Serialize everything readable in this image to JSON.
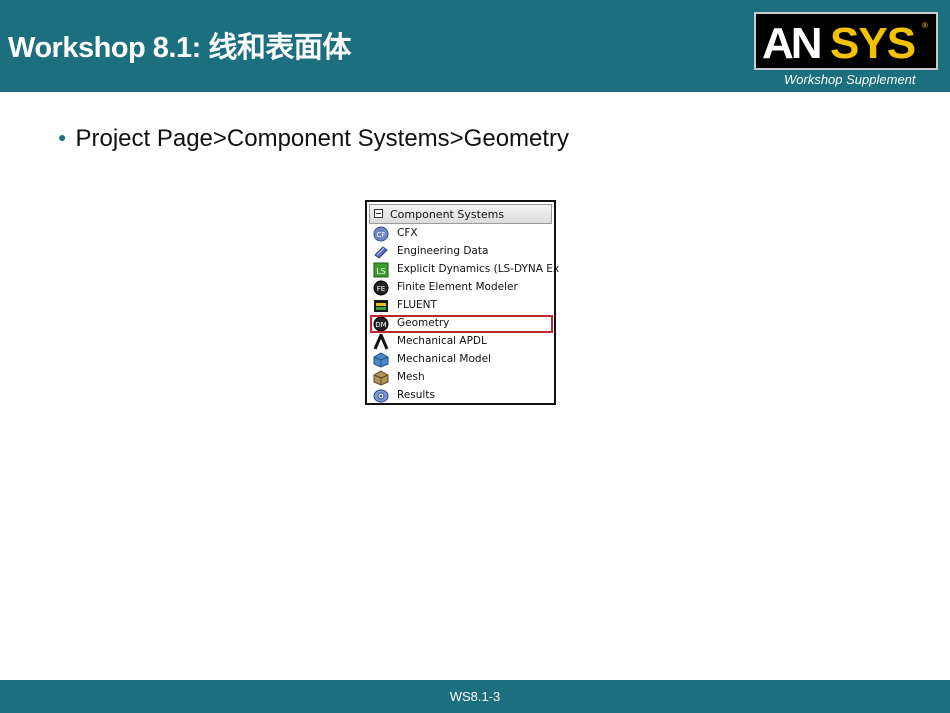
{
  "header": {
    "title": "Workshop 8.1: 线和表面体",
    "logo_text": "ANSYS",
    "supplement": "Workshop Supplement"
  },
  "bullet": {
    "text": "Project Page>Component Systems>Geometry"
  },
  "panel": {
    "title": "Component Systems",
    "items": [
      {
        "label": "CFX",
        "icon": "cfx-icon"
      },
      {
        "label": "Engineering Data",
        "icon": "engineering-data-icon"
      },
      {
        "label": "Explicit Dynamics (LS-DYNA Ex",
        "icon": "explicit-dynamics-icon"
      },
      {
        "label": "Finite Element Modeler",
        "icon": "fe-modeler-icon"
      },
      {
        "label": "FLUENT",
        "icon": "fluent-icon"
      },
      {
        "label": "Geometry",
        "icon": "geometry-icon"
      },
      {
        "label": "Mechanical APDL",
        "icon": "mechanical-apdl-icon"
      },
      {
        "label": "Mechanical Model",
        "icon": "mechanical-model-icon"
      },
      {
        "label": "Mesh",
        "icon": "mesh-icon"
      },
      {
        "label": "Results",
        "icon": "results-icon"
      }
    ],
    "highlighted": "Geometry"
  },
  "footer": {
    "page": "WS8.1-3"
  },
  "colors": {
    "band": "#1b6f7f",
    "highlight": "#c0262d",
    "logo_yellow": "#f2c200"
  }
}
